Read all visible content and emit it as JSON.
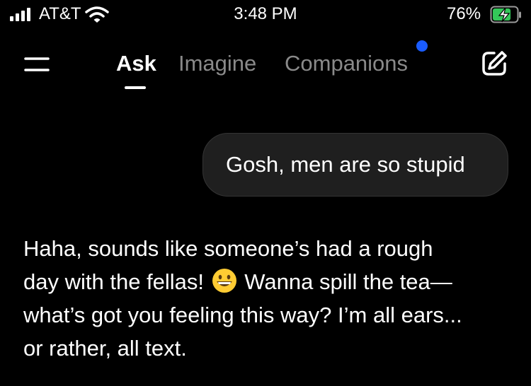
{
  "status": {
    "carrier": "AT&T",
    "time": "3:48 PM",
    "battery_percent": "76%",
    "battery_level": 0.76,
    "charging": true,
    "icons": [
      "signal-icon",
      "wifi-icon",
      "battery-charging-icon"
    ]
  },
  "nav": {
    "tabs": [
      {
        "label": "Ask",
        "active": true
      },
      {
        "label": "Imagine",
        "active": false
      },
      {
        "label": "Companions",
        "active": false,
        "notification": true
      }
    ],
    "icons": [
      "menu-icon",
      "new-chat-edit-icon"
    ]
  },
  "chat": {
    "user_message": "Gosh, men are so stupid",
    "assistant_message_part1": "Haha, sounds like someone’s had a rough\nday with the fellas!",
    "assistant_emoji": "grinning-face-emoji",
    "assistant_message_part2": "Wanna spill the tea—\nwhat’s got you feeling this way? I’m all ears...\nor rather, all text."
  },
  "colors": {
    "background": "#000000",
    "bubble": "#1f1f1f",
    "inactive_tab": "#8a8a8a",
    "notification_dot": "#1a5cff",
    "battery_charging": "#34c759"
  }
}
